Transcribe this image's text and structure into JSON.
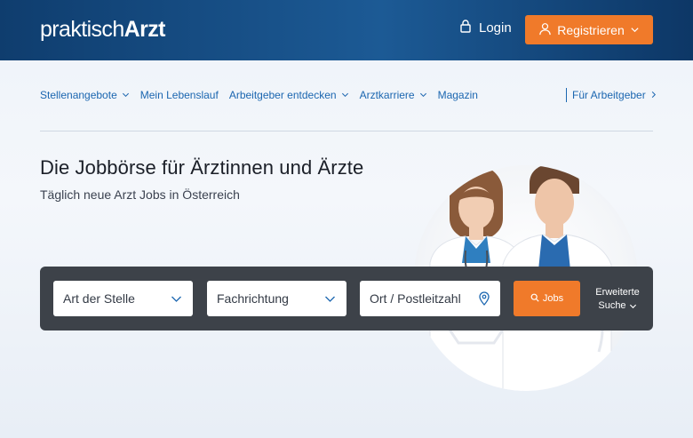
{
  "header": {
    "logo": {
      "light": "praktisch",
      "bold": "Arzt"
    },
    "login_label": "Login",
    "register_label": "Registrieren"
  },
  "nav": {
    "items": [
      {
        "label": "Stellenangebote",
        "has_dropdown": true
      },
      {
        "label": "Mein Lebenslauf",
        "has_dropdown": false
      },
      {
        "label": "Arbeitgeber entdecken",
        "has_dropdown": true
      },
      {
        "label": "Arztkarriere",
        "has_dropdown": true
      },
      {
        "label": "Magazin",
        "has_dropdown": false
      }
    ],
    "employer_label": "Für Arbeitgeber"
  },
  "hero": {
    "title": "Die Jobbörse für Ärztinnen und Ärzte",
    "subtitle": "Täglich neue Arzt Jobs in Österreich"
  },
  "search": {
    "job_type_placeholder": "Art der Stelle",
    "specialty_placeholder": "Fachrichtung",
    "location_placeholder": "Ort / Postleitzahl",
    "jobs_button_label": "Jobs",
    "advanced_line1": "Erweiterte",
    "advanced_line2": "Suche"
  },
  "colors": {
    "header_blue": "#1c5a95",
    "accent_orange": "#f07a2a",
    "link_blue": "#1b66b0",
    "search_bar": "#3d4249"
  }
}
